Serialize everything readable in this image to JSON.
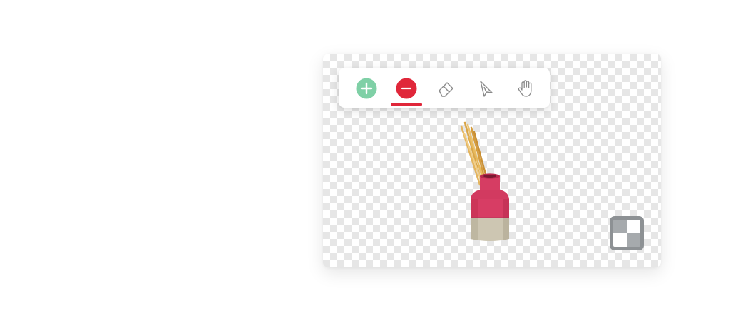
{
  "toolbar": {
    "tools": [
      {
        "name": "add",
        "icon": "plus-circle-icon",
        "color": "#7fd0a6",
        "active": false
      },
      {
        "name": "remove",
        "icon": "minus-circle-icon",
        "color": "#e0273a",
        "active": true
      },
      {
        "name": "erase",
        "icon": "eraser-icon",
        "color": "#8a8a8a",
        "active": false
      },
      {
        "name": "select",
        "icon": "cursor-arrow-icon",
        "color": "#8a8a8a",
        "active": false
      },
      {
        "name": "pan",
        "icon": "hand-icon",
        "color": "#8a8a8a",
        "active": false
      }
    ],
    "active_indicator_color": "#e0273a"
  },
  "canvas": {
    "background": "transparent-checkerboard",
    "subject": "reed-diffuser-image"
  },
  "background_toggle": {
    "icon": "checkerboard-icon"
  }
}
